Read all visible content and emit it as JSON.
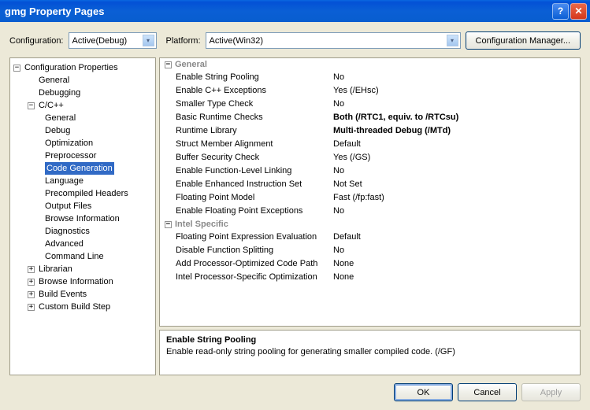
{
  "title": "gmg Property Pages",
  "toprow": {
    "config_label": "Configuration:",
    "config_value": "Active(Debug)",
    "platform_label": "Platform:",
    "platform_value": "Active(Win32)",
    "cm_button": "Configuration Manager..."
  },
  "tree": {
    "root": "Configuration Properties",
    "general": "General",
    "debugging": "Debugging",
    "ccpp": "C/C++",
    "ccpp_children": {
      "general": "General",
      "debug": "Debug",
      "optimization": "Optimization",
      "preprocessor": "Preprocessor",
      "codegen": "Code Generation",
      "language": "Language",
      "pch": "Precompiled Headers",
      "outputfiles": "Output Files",
      "browseinfo": "Browse Information",
      "diagnostics": "Diagnostics",
      "advanced": "Advanced",
      "cmdline": "Command Line"
    },
    "librarian": "Librarian",
    "browseinfo2": "Browse Information",
    "buildevents": "Build Events",
    "custombuild": "Custom Build Step"
  },
  "grid": {
    "cat_general": "General",
    "rows_general": [
      {
        "name": "Enable String Pooling",
        "val": "No",
        "bold": false
      },
      {
        "name": "Enable C++ Exceptions",
        "val": "Yes (/EHsc)",
        "bold": false
      },
      {
        "name": "Smaller Type Check",
        "val": "No",
        "bold": false
      },
      {
        "name": "Basic Runtime Checks",
        "val": "Both (/RTC1, equiv. to /RTCsu)",
        "bold": true
      },
      {
        "name": "Runtime Library",
        "val": "Multi-threaded Debug (/MTd)",
        "bold": true
      },
      {
        "name": "Struct Member Alignment",
        "val": "Default",
        "bold": false
      },
      {
        "name": "Buffer Security Check",
        "val": "Yes (/GS)",
        "bold": false
      },
      {
        "name": "Enable Function-Level Linking",
        "val": "No",
        "bold": false
      },
      {
        "name": "Enable Enhanced Instruction Set",
        "val": "Not Set",
        "bold": false
      },
      {
        "name": "Floating Point Model",
        "val": "Fast (/fp:fast)",
        "bold": false
      },
      {
        "name": "Enable Floating Point Exceptions",
        "val": "No",
        "bold": false
      }
    ],
    "cat_intel": "Intel Specific",
    "rows_intel": [
      {
        "name": "Floating Point Expression Evaluation",
        "val": "Default",
        "bold": false
      },
      {
        "name": "Disable Function Splitting",
        "val": "No",
        "bold": false
      },
      {
        "name": "Add Processor-Optimized Code Path",
        "val": "None",
        "bold": false
      },
      {
        "name": "Intel Processor-Specific Optimization",
        "val": "None",
        "bold": false
      }
    ]
  },
  "desc": {
    "title": "Enable String Pooling",
    "body": "Enable read-only string pooling for generating smaller compiled code.     (/GF)"
  },
  "buttons": {
    "ok": "OK",
    "cancel": "Cancel",
    "apply": "Apply"
  }
}
